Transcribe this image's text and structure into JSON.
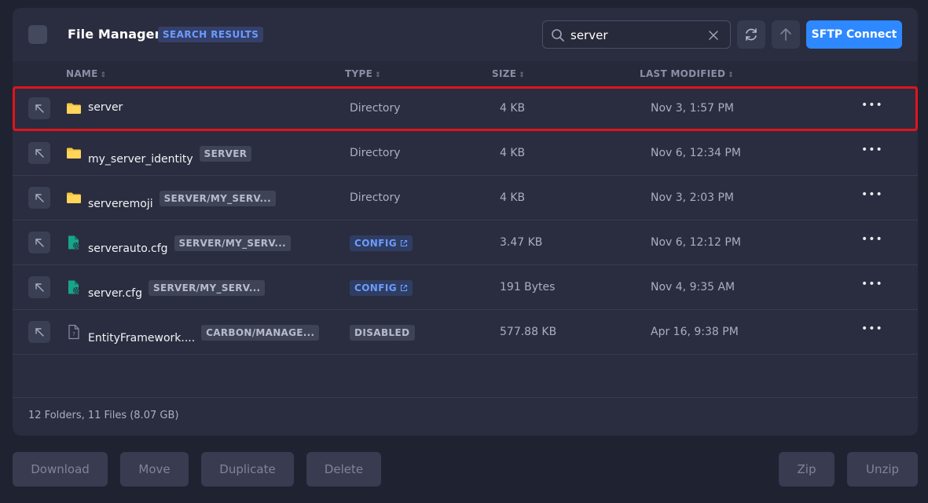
{
  "header": {
    "title": "File Manager",
    "badge": "SEARCH RESULTS",
    "search": {
      "value": "server",
      "placeholder": ""
    },
    "sftp_label": "SFTP Connect"
  },
  "columns": {
    "name": "NAME",
    "type": "TYPE",
    "size": "SIZE",
    "modified": "LAST MODIFIED"
  },
  "rows": [
    {
      "name": "server",
      "path": "",
      "icon": "folder-icon",
      "type": "Directory",
      "type_kind": "text",
      "size": "4 KB",
      "modified": "Nov 3, 1:57 PM",
      "highlighted": true
    },
    {
      "name": "my_server_identity",
      "path": "SERVER",
      "icon": "folder-icon",
      "type": "Directory",
      "type_kind": "text",
      "size": "4 KB",
      "modified": "Nov 6, 12:34 PM"
    },
    {
      "name": "serveremoji",
      "path": "SERVER/MY_SERV...",
      "icon": "folder-icon",
      "type": "Directory",
      "type_kind": "text",
      "size": "4 KB",
      "modified": "Nov 3, 2:03 PM"
    },
    {
      "name": "serverauto.cfg",
      "path": "SERVER/MY_SERV...",
      "icon": "config-file-icon",
      "type": "CONFIG",
      "type_kind": "config",
      "size": "3.47 KB",
      "modified": "Nov 6, 12:12 PM"
    },
    {
      "name": "server.cfg",
      "path": "SERVER/MY_SERV...",
      "icon": "config-file-icon",
      "type": "CONFIG",
      "type_kind": "config",
      "size": "191 Bytes",
      "modified": "Nov 4, 9:35 AM"
    },
    {
      "name": "EntityFramework....",
      "path": "CARBON/MANAGE...",
      "icon": "unknown-file-icon",
      "type": "DISABLED",
      "type_kind": "disabled",
      "size": "577.88 KB",
      "modified": "Apr 16, 9:38 PM"
    }
  ],
  "footer": {
    "summary": "12 Folders, 11 Files (8.07 GB)"
  },
  "actions": {
    "download": "Download",
    "move": "Move",
    "duplicate": "Duplicate",
    "delete": "Delete",
    "zip": "Zip",
    "unzip": "Unzip"
  },
  "colors": {
    "accent": "#2e88ff",
    "folder": "#f5c542",
    "config_icon": "#17a589",
    "highlight": "#e0141b"
  }
}
